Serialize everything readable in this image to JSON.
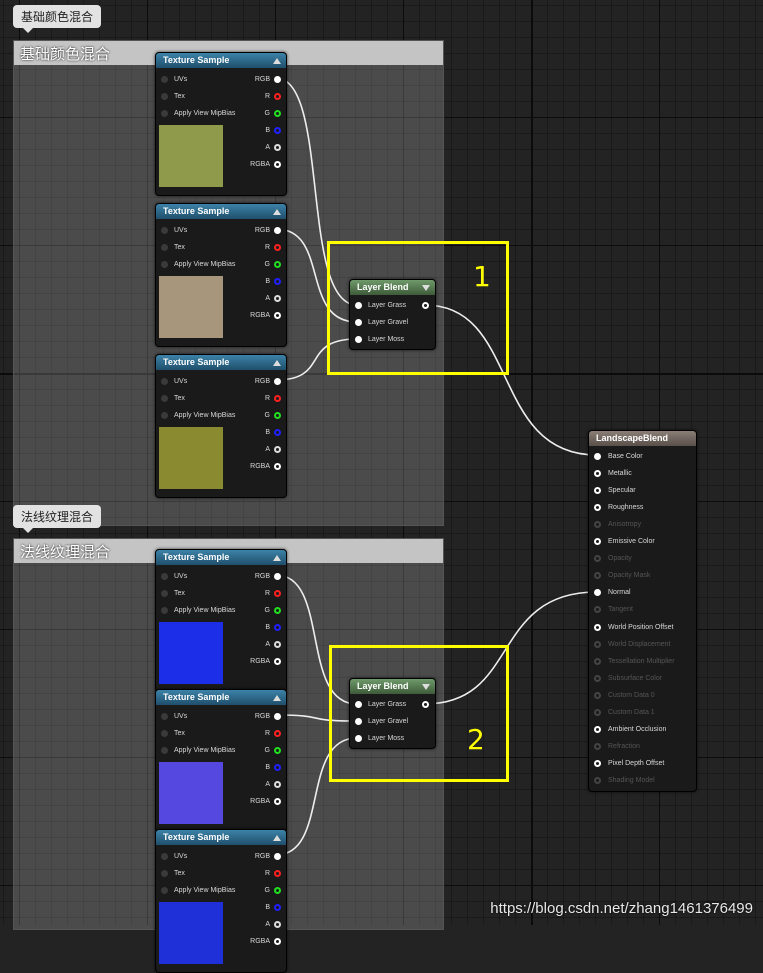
{
  "comments": [
    {
      "tag": "基础颜色混合",
      "title": "基础颜色混合"
    },
    {
      "tag": "法线纹理混合",
      "title": "法线纹理混合"
    }
  ],
  "texture_sample": {
    "title": "Texture Sample",
    "inputs": [
      "UVs",
      "Tex",
      "Apply View MipBias"
    ],
    "outputs": [
      "RGB",
      "R",
      "G",
      "B",
      "A",
      "RGBA"
    ]
  },
  "layer_blend": {
    "title": "Layer Blend",
    "inputs": [
      "Layer Grass",
      "Layer Gravel",
      "Layer Moss"
    ]
  },
  "landscape_blend": {
    "title": "LandscapeBlend",
    "pins": [
      "Base Color",
      "Metallic",
      "Specular",
      "Roughness",
      "Anisotropy",
      "Emissive Color",
      "Opacity",
      "Opacity Mask",
      "Normal",
      "Tangent",
      "World Position Offset",
      "World Displacement",
      "Tessellation Multiplier",
      "Subsurface Color",
      "Custom Data 0",
      "Custom Data 1",
      "Ambient Occlusion",
      "Refraction",
      "Pixel Depth Offset",
      "Shading Model"
    ],
    "enabled": [
      true,
      true,
      true,
      true,
      false,
      true,
      false,
      false,
      true,
      false,
      true,
      false,
      false,
      false,
      false,
      false,
      true,
      false,
      true,
      false
    ]
  },
  "annotations": [
    "1",
    "2"
  ],
  "watermark": "https://blog.csdn.net/zhang1461376499",
  "colors": {
    "grass": "#8f9a4a",
    "gravel": "#a8967c",
    "moss": "#8a8a30",
    "normal1": "#1c2ee8",
    "normal2": "#5548e0",
    "normal3": "#2030d8",
    "box": "#ffff00"
  }
}
